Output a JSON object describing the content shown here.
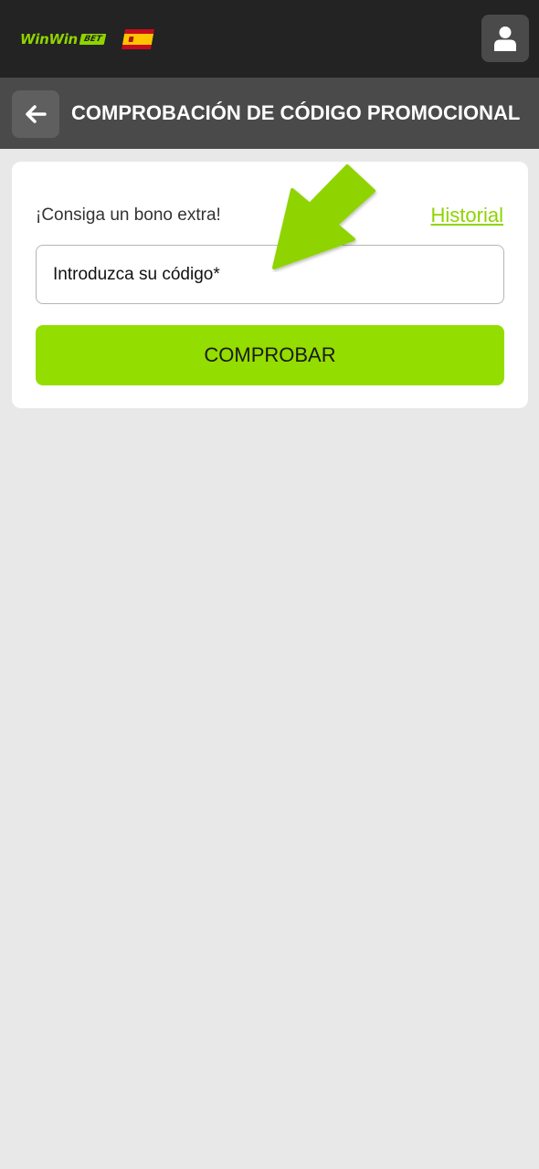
{
  "header": {
    "logo_text": "WinWin",
    "logo_badge": "BET",
    "language_flag": "spain-flag-icon",
    "user_icon": "user-icon"
  },
  "subheader": {
    "back_icon": "arrow-left-icon",
    "title": "COMPROBACIÓN DE CÓDIGO PROMOCIONAL"
  },
  "promo": {
    "bonus_text": "¡Consiga un bono extra!",
    "history_link": "Historial",
    "input_placeholder": "Introduzca su código*",
    "input_value": "",
    "submit_label": "COMPROBAR"
  },
  "annotation": {
    "arrow_icon": "green-pointer-arrow-icon",
    "color": "#8fd400"
  },
  "colors": {
    "accent": "#94dd00",
    "topbar": "#232323",
    "subheader": "#4a4a4a",
    "background": "#e8e8e8"
  }
}
